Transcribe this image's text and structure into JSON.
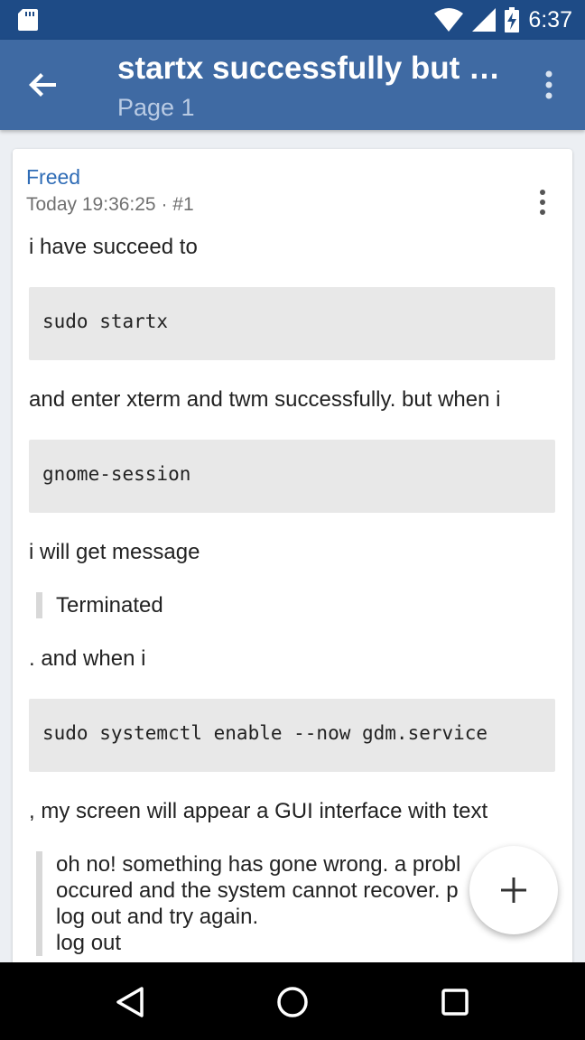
{
  "status_bar": {
    "time": "6:37",
    "icons": [
      "sd-card-icon",
      "wifi-icon",
      "signal-icon",
      "battery-charging-icon"
    ]
  },
  "app_bar": {
    "title": "startx successfully but f…",
    "subtitle": "Page 1",
    "icons": [
      "back-arrow-icon",
      "overflow-menu-icon"
    ]
  },
  "post": {
    "author": "Freed",
    "meta": "Today 19:36:25 · #1",
    "paragraphs": {
      "p1": "i have succeed to",
      "p2": "and enter xterm and twm successfully. but when i",
      "p3": "i will get message",
      "p4": ". and when i",
      "p5": ", my screen will appear a GUI interface with text"
    },
    "code_blocks": {
      "c1": "sudo startx",
      "c2": "gnome-session",
      "c3": "sudo systemctl enable --now gdm.service"
    },
    "quotes": {
      "q1": "Terminated",
      "q2": {
        "line1": "oh no! something has gone wrong. a probl",
        "line2": "occured and the system cannot recover. p",
        "line3": "log out and try again.",
        "line4": "log out"
      }
    }
  },
  "fab": {
    "icon": "plus-icon"
  },
  "nav_bar": {
    "icons": [
      "nav-back-icon",
      "nav-home-icon",
      "nav-recents-icon"
    ]
  },
  "colors": {
    "status_bar": "#1e4b86",
    "app_bar": "#3f6aa3",
    "author_link": "#2f6cb6",
    "code_bg": "#e8e8e8"
  }
}
